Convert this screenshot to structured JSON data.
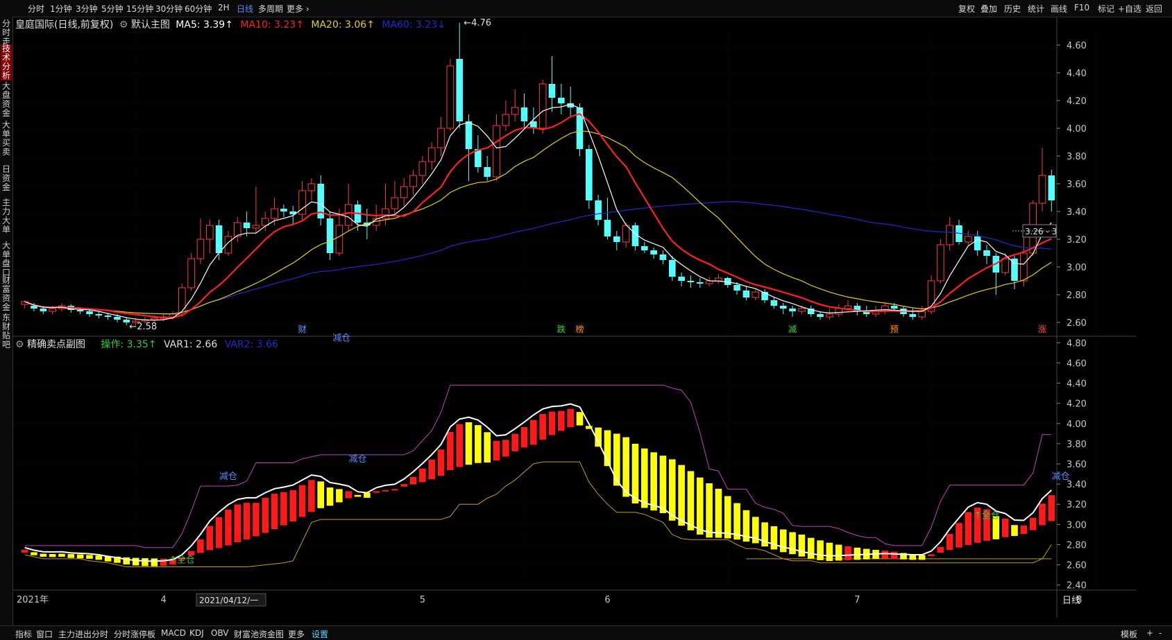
{
  "topbar": {
    "left_items": [
      "分时",
      "1分钟",
      "3分钟",
      "5分钟",
      "15分钟",
      "30分钟",
      "60分钟",
      "2H",
      "日线",
      "多周期",
      "更多 ›"
    ],
    "active_left": "日线",
    "right_items": [
      "复权",
      "叠加",
      "历史",
      "统计",
      "画线",
      "F10",
      "标记",
      "+自选",
      "返回"
    ]
  },
  "sidebar": {
    "tabs": [
      "分时走势",
      "技术分析",
      "大盘资金",
      "大单买卖",
      "日资金",
      "主力大单",
      "大单盘口",
      "财富资金",
      "东财贴吧"
    ],
    "active": "技术分析"
  },
  "main_legend": {
    "title": "皇庭国际(日线,前复权)",
    "preset": "默认主图",
    "ma5": "MA5: 3.39↑",
    "ma10": "MA10: 3.23↑",
    "ma20": "MA20: 3.06↑",
    "ma60": "MA60: 3.23↓"
  },
  "sub_legend": {
    "title": "精确卖点副图",
    "op": "操作: 3.35↑",
    "var1": "VAR1: 2.66",
    "var2": "VAR2: 3.66"
  },
  "main_yaxis": [
    "4.60",
    "4.40",
    "4.20",
    "4.00",
    "3.80",
    "3.60",
    "3.40",
    "3.20",
    "3.00",
    "2.80",
    "2.60"
  ],
  "sub_yaxis": [
    "4.80",
    "4.60",
    "4.40",
    "4.20",
    "4.00",
    "3.80",
    "3.60",
    "3.40",
    "3.20",
    "3.00",
    "2.80",
    "2.60",
    "2.40"
  ],
  "annotations": {
    "high": "4.76",
    "low": "2.58",
    "last_price": "3.26"
  },
  "event_marks": [
    {
      "label": "财",
      "color": "#5a8cff"
    },
    {
      "label": "跌",
      "color": "#2ecc40"
    },
    {
      "label": "榜",
      "color": "#ff8c00"
    },
    {
      "label": "减",
      "color": "#2ecc40"
    },
    {
      "label": "预",
      "color": "#ff8c00"
    },
    {
      "label": "涨",
      "color": "#ff3b3b"
    }
  ],
  "sub_texts": {
    "reduce": "减仓",
    "full": "↑全仓"
  },
  "xaxis": {
    "labels": [
      "2021年",
      "4",
      "5",
      "6",
      "7",
      "8"
    ],
    "cursor_date": "2021/04/12/一",
    "period": "日线"
  },
  "bottombar": {
    "items": [
      "指标",
      "窗口",
      "主力进出分时",
      "分时涨停板",
      "MACD",
      "KDJ",
      "OBV",
      "财富池资金图",
      "更多",
      "设置"
    ],
    "active": "设置",
    "right_items": [
      "模板",
      "+",
      "-"
    ]
  },
  "colors": {
    "up": "#ff3b3b",
    "down": "#54ffff",
    "ma5": "#ffffff",
    "ma10": "#ff2020",
    "ma20": "#e6d200",
    "ma60": "#1a2bd6",
    "var_upper": "#c040c0",
    "var_lower": "#c8a000"
  },
  "chart_data": {
    "type": "candlestick",
    "title": "皇庭国际(日线,前复权)",
    "ylim": [
      2.5,
      4.8
    ],
    "candles": [
      [
        2.73,
        2.75,
        2.7,
        2.76
      ],
      [
        2.72,
        2.7,
        2.68,
        2.74
      ],
      [
        2.7,
        2.68,
        2.66,
        2.72
      ],
      [
        2.68,
        2.7,
        2.66,
        2.72
      ],
      [
        2.7,
        2.72,
        2.68,
        2.74
      ],
      [
        2.72,
        2.69,
        2.67,
        2.73
      ],
      [
        2.69,
        2.68,
        2.66,
        2.71
      ],
      [
        2.68,
        2.66,
        2.64,
        2.7
      ],
      [
        2.66,
        2.65,
        2.63,
        2.68
      ],
      [
        2.65,
        2.64,
        2.62,
        2.67
      ],
      [
        2.64,
        2.62,
        2.6,
        2.66
      ],
      [
        2.62,
        2.6,
        2.58,
        2.64
      ],
      [
        2.6,
        2.61,
        2.58,
        2.63
      ],
      [
        2.61,
        2.62,
        2.59,
        2.64
      ],
      [
        2.62,
        2.63,
        2.6,
        2.65
      ],
      [
        2.63,
        2.64,
        2.61,
        2.66
      ],
      [
        2.64,
        2.66,
        2.62,
        2.68
      ],
      [
        2.66,
        2.85,
        2.64,
        2.88
      ],
      [
        2.85,
        3.06,
        2.83,
        3.1
      ],
      [
        3.06,
        3.2,
        3.02,
        3.35
      ],
      [
        3.2,
        3.3,
        3.1,
        3.34
      ],
      [
        3.3,
        3.1,
        3.05,
        3.34
      ],
      [
        3.1,
        3.22,
        3.08,
        3.26
      ],
      [
        3.22,
        3.32,
        3.18,
        3.36
      ],
      [
        3.32,
        3.28,
        3.22,
        3.4
      ],
      [
        3.28,
        3.3,
        3.24,
        3.58
      ],
      [
        3.3,
        3.35,
        3.26,
        3.4
      ],
      [
        3.35,
        3.42,
        3.3,
        3.5
      ],
      [
        3.42,
        3.4,
        3.36,
        3.45
      ],
      [
        3.4,
        3.38,
        3.3,
        3.44
      ],
      [
        3.38,
        3.55,
        3.34,
        3.62
      ],
      [
        3.55,
        3.6,
        3.48,
        3.64
      ],
      [
        3.6,
        3.35,
        3.3,
        3.66
      ],
      [
        3.35,
        3.1,
        3.05,
        3.4
      ],
      [
        3.1,
        3.3,
        3.08,
        3.42
      ],
      [
        3.3,
        3.45,
        3.26,
        3.6
      ],
      [
        3.45,
        3.32,
        3.26,
        3.48
      ],
      [
        3.32,
        3.3,
        3.2,
        3.42
      ],
      [
        3.3,
        3.35,
        3.26,
        3.45
      ],
      [
        3.35,
        3.42,
        3.3,
        3.6
      ],
      [
        3.42,
        3.5,
        3.38,
        3.62
      ],
      [
        3.5,
        3.58,
        3.44,
        3.64
      ],
      [
        3.58,
        3.66,
        3.52,
        3.7
      ],
      [
        3.66,
        3.76,
        3.6,
        3.8
      ],
      [
        3.76,
        3.86,
        3.7,
        3.9
      ],
      [
        3.86,
        4.0,
        3.8,
        4.08
      ],
      [
        4.0,
        4.45,
        3.98,
        4.5
      ],
      [
        4.5,
        4.05,
        4.0,
        4.76
      ],
      [
        4.05,
        3.85,
        3.62,
        4.1
      ],
      [
        3.85,
        3.72,
        3.68,
        3.95
      ],
      [
        3.72,
        3.65,
        3.62,
        3.8
      ],
      [
        3.65,
        4.02,
        3.62,
        4.1
      ],
      [
        4.02,
        4.1,
        3.98,
        4.2
      ],
      [
        4.1,
        4.15,
        4.05,
        4.28
      ],
      [
        4.15,
        4.05,
        4.0,
        4.25
      ],
      [
        4.05,
        4.0,
        3.96,
        4.15
      ],
      [
        4.0,
        4.32,
        3.96,
        4.35
      ],
      [
        4.32,
        4.22,
        4.12,
        4.52
      ],
      [
        4.22,
        4.18,
        4.1,
        4.32
      ],
      [
        4.18,
        4.15,
        4.08,
        4.3
      ],
      [
        4.15,
        3.85,
        3.8,
        4.18
      ],
      [
        3.85,
        3.48,
        3.42,
        3.88
      ],
      [
        3.48,
        3.34,
        3.3,
        3.52
      ],
      [
        3.34,
        3.22,
        3.2,
        3.5
      ],
      [
        3.22,
        3.18,
        3.12,
        3.26
      ],
      [
        3.18,
        3.3,
        3.14,
        3.32
      ],
      [
        3.3,
        3.15,
        3.12,
        3.32
      ],
      [
        3.15,
        3.12,
        3.1,
        3.18
      ],
      [
        3.12,
        3.09,
        3.06,
        3.14
      ],
      [
        3.09,
        3.05,
        3.02,
        3.12
      ],
      [
        3.05,
        2.93,
        2.9,
        3.08
      ],
      [
        2.93,
        2.9,
        2.86,
        2.96
      ],
      [
        2.9,
        2.89,
        2.85,
        2.94
      ],
      [
        2.89,
        2.88,
        2.85,
        2.92
      ],
      [
        2.88,
        2.9,
        2.86,
        2.93
      ],
      [
        2.9,
        2.92,
        2.88,
        2.95
      ],
      [
        2.92,
        2.87,
        2.85,
        2.93
      ],
      [
        2.87,
        2.83,
        2.8,
        2.89
      ],
      [
        2.83,
        2.78,
        2.76,
        2.86
      ],
      [
        2.78,
        2.82,
        2.76,
        2.84
      ],
      [
        2.82,
        2.76,
        2.74,
        2.84
      ],
      [
        2.76,
        2.72,
        2.7,
        2.78
      ],
      [
        2.72,
        2.7,
        2.66,
        2.74
      ],
      [
        2.7,
        2.68,
        2.64,
        2.72
      ],
      [
        2.68,
        2.7,
        2.66,
        2.72
      ],
      [
        2.7,
        2.66,
        2.64,
        2.72
      ],
      [
        2.66,
        2.64,
        2.62,
        2.68
      ],
      [
        2.64,
        2.66,
        2.62,
        2.7
      ],
      [
        2.66,
        2.7,
        2.64,
        2.73
      ],
      [
        2.7,
        2.72,
        2.68,
        2.76
      ],
      [
        2.72,
        2.68,
        2.65,
        2.74
      ],
      [
        2.68,
        2.66,
        2.64,
        2.72
      ],
      [
        2.66,
        2.68,
        2.64,
        2.72
      ],
      [
        2.68,
        2.72,
        2.66,
        2.74
      ],
      [
        2.72,
        2.7,
        2.68,
        2.74
      ],
      [
        2.7,
        2.66,
        2.64,
        2.72
      ],
      [
        2.66,
        2.64,
        2.62,
        2.7
      ],
      [
        2.64,
        2.68,
        2.62,
        2.72
      ],
      [
        2.68,
        2.9,
        2.66,
        2.94
      ],
      [
        2.9,
        3.16,
        2.88,
        3.2
      ],
      [
        3.16,
        3.3,
        3.12,
        3.36
      ],
      [
        3.3,
        3.18,
        3.16,
        3.34
      ],
      [
        3.18,
        3.22,
        3.16,
        3.26
      ],
      [
        3.22,
        3.12,
        3.08,
        3.26
      ],
      [
        3.12,
        3.08,
        3.02,
        3.16
      ],
      [
        3.08,
        2.96,
        2.8,
        3.1
      ],
      [
        2.96,
        3.06,
        2.94,
        3.1
      ],
      [
        3.06,
        2.9,
        2.84,
        3.08
      ],
      [
        2.9,
        3.1,
        2.86,
        3.24
      ],
      [
        3.1,
        3.46,
        3.08,
        3.48
      ],
      [
        3.46,
        3.66,
        3.4,
        3.86
      ],
      [
        3.66,
        3.48,
        3.4,
        3.7
      ]
    ],
    "ma5_note": "moving averages drawn from closes",
    "sub": {
      "title": "精确卖点副图",
      "ylim": [
        2.35,
        4.85
      ]
    }
  }
}
